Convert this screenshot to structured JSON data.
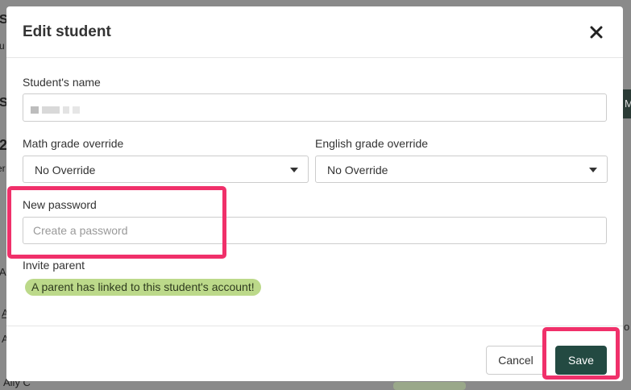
{
  "background": {
    "fragments": [
      "S",
      "u",
      "S",
      "2",
      "er",
      "A",
      "A",
      "A",
      "Ally C",
      "o",
      "M"
    ]
  },
  "modal": {
    "title": "Edit student",
    "close_icon": "close-icon"
  },
  "form": {
    "name_label": "Student's name",
    "name_value": "",
    "math_label": "Math grade override",
    "math_value": "No Override",
    "english_label": "English grade override",
    "english_value": "No Override",
    "password_label": "New password",
    "password_placeholder": "Create a password",
    "invite_label": "Invite parent",
    "parent_badge": "A parent has linked to this student's account!"
  },
  "footer": {
    "cancel_label": "Cancel",
    "save_label": "Save"
  },
  "colors": {
    "highlight": "#f0306a",
    "save_button": "#234a42",
    "badge": "#bcd98a"
  }
}
